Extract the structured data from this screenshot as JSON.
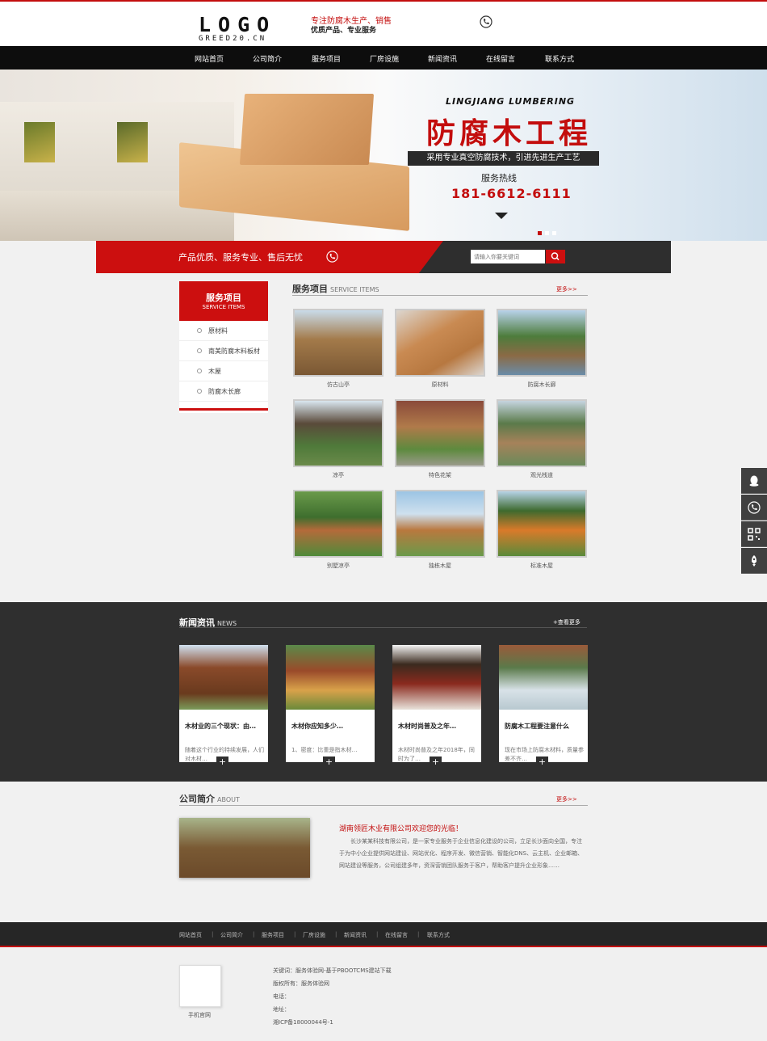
{
  "header": {
    "logo_main": "LOGO",
    "logo_sub": "GREED20.CN",
    "tagline_1": "专注防腐木生产、销售",
    "tagline_2": "优质产品、专业服务"
  },
  "nav": [
    "网站首页",
    "公司简介",
    "服务项目",
    "厂房设施",
    "新闻资讯",
    "在线留言",
    "联系方式"
  ],
  "banner": {
    "en_title": "LINGJIANG LUMBERING",
    "big_title": "防腐木工程",
    "strip": "采用专业真空防腐技术，引进先进生产工艺",
    "hotline_label": "服务热线",
    "hotline": "181-6612-6111"
  },
  "slogan": {
    "text": "产品优质、服务专业、售后无忧",
    "search_placeholder": "请输入你要关键词"
  },
  "sidebar": {
    "title": "服务项目",
    "en": "SERVICE ITEMS",
    "items": [
      "原材料",
      "南美防腐木料板材",
      "木屋",
      "防腐木长廊"
    ]
  },
  "services": {
    "title": "服务项目",
    "en": "SERVICE ITEMS",
    "more": "更多>>",
    "items": [
      "仿古山亭",
      "原材料",
      "防腐木长廊",
      "凉亭",
      "特色花架",
      "观光栈道",
      "别墅凉亭",
      "独栋木屋",
      "标准木屋"
    ]
  },
  "news": {
    "title": "新闻资讯",
    "en": "NEWS",
    "more": "+查看更多",
    "items": [
      {
        "title": "木材业的三个现状：由…",
        "desc": "随着这个行业的持续发展，人们对木材…"
      },
      {
        "title": "木材你应知多少…",
        "desc": "1、密度：比重是指木材…"
      },
      {
        "title": "木材时尚普及之年…",
        "desc": "木材时尚普及之年2018年，同时为了…"
      },
      {
        "title": "防腐木工程要注意什么",
        "desc": "现在市场上防腐木材料，质量参差不齐…"
      }
    ]
  },
  "about": {
    "title": "公司简介",
    "en": "ABOUT",
    "more": "更多>>",
    "heading": "湖南领匠木业有限公司欢迎您的光临！",
    "text": "长沙某某科技有限公司，是一家专业服务于企业信息化建设的公司，立足长沙面向全国，专注于为中小企业提供网站建设、网站优化、程序开发、微信营销、智能化DNS、云主机、企业邮箱、网站建设等服务，公司组建多年，资深营销团队服务于客户，帮助客户提升企业形象……"
  },
  "footer": {
    "nav": [
      "网站首页",
      "公司简介",
      "服务项目",
      "厂房设施",
      "新闻资讯",
      "在线留言",
      "联系方式"
    ],
    "qr_caption": "手机官网",
    "lines": [
      "关键词：服务体验网-基于PBOOTCMS建站下载",
      "版权所有：服务体验网",
      "电话：",
      "地址：",
      "湘ICP备18000044号-1"
    ]
  },
  "colors": {
    "accent": "#cc0f0f",
    "dark": "#2f2f2f"
  }
}
